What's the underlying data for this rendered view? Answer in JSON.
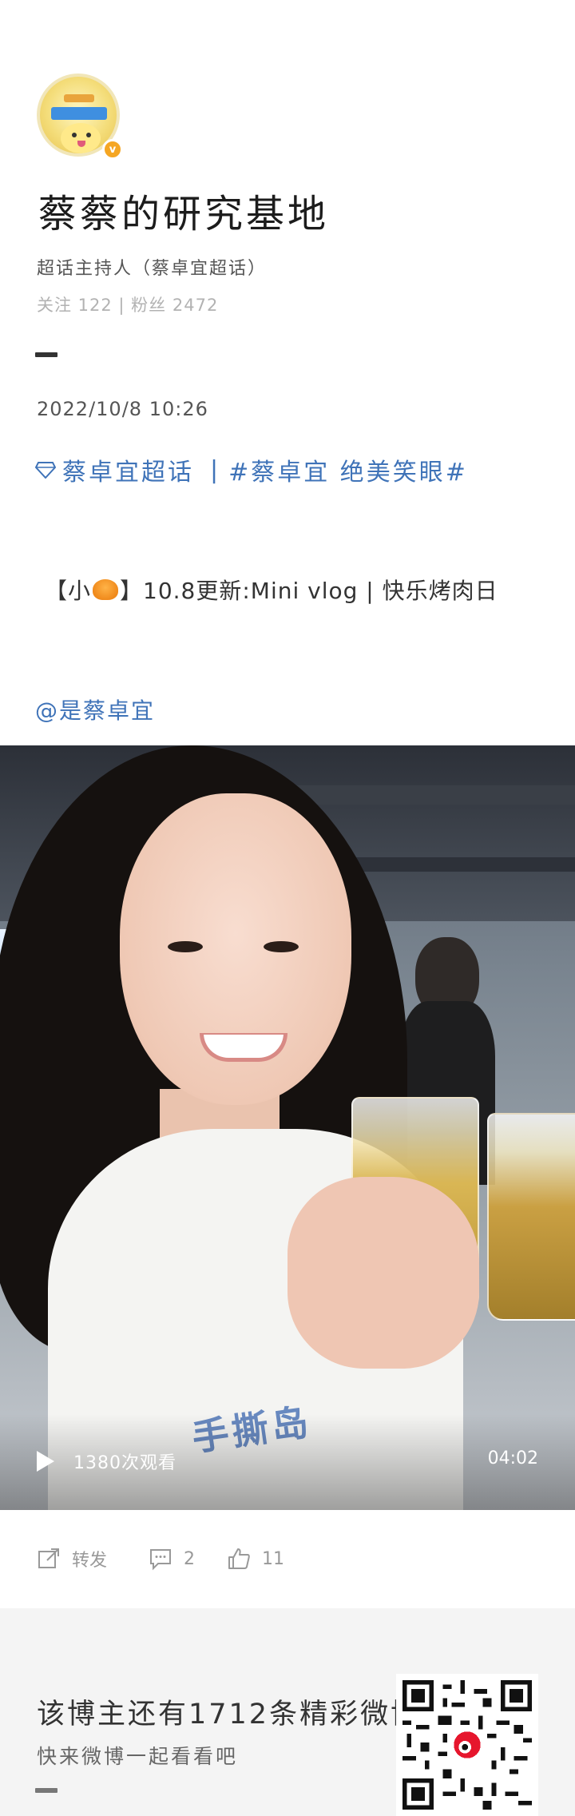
{
  "profile": {
    "avatar_alt": "avatar",
    "verified_badge": "v",
    "name": "蔡蔡的研究基地",
    "role": "超话主持人（蔡卓宜超话）",
    "stats": "关注 122 | 粉丝 2472"
  },
  "post": {
    "date": "2022/10/8 10:26",
    "topic_supertopic": "蔡卓宜超话",
    "topic_separator": "|",
    "topic_hashtag": "#蔡卓宜 绝美笑眼#",
    "headline_prefix": "【小",
    "headline_suffix": "】10.8更新:Mini vlog | 快乐烤肉日",
    "mention": "@是蔡卓宜"
  },
  "video": {
    "views": "1380次观看",
    "duration": "04:02",
    "shirt_text": "手撕岛"
  },
  "actions": {
    "repost_label": "转发",
    "comment_count": "2",
    "like_count": "11"
  },
  "footer": {
    "line1": "该博主还有1712条精彩微博",
    "line2": "快来微博一起看看吧"
  },
  "colors": {
    "link_blue": "#3f73b8",
    "badge_orange": "#f5a623",
    "footer_bg": "#f4f4f4"
  }
}
